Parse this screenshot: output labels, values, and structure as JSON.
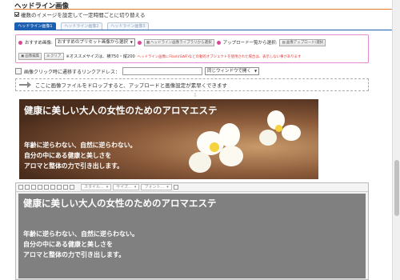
{
  "section": {
    "title": "ヘッドライン画像",
    "rotate_label": "複数のイメージを設定して一定時間ごとに切り替える",
    "rotate_checked": true
  },
  "tabs": [
    "ヘッドライン画像1",
    "ヘッドライン画像2",
    "ヘッドライン画像3"
  ],
  "settings": {
    "preset_label": "おすすめ画像:",
    "preset_select": "おすすめのプリセット画像から選択",
    "library_button": "ヘッドライン画像ライブラリから選択",
    "upload_label": "アップロード一覧から選択:",
    "upload_button": "画像アップロード/選択",
    "edit_button": "画像編集",
    "clear_button": "クリア",
    "size_note": "※オススメサイズは、横750・縦200",
    "warning": "ヘッドライン画像にFlash(SWF)などの動的オブジェクトを使用された場合は、表示しない事があります"
  },
  "link": {
    "label": "画像クリック時に遷移するリンクアドレス：",
    "value": "",
    "window_select": "同じウィンドウで開く"
  },
  "drop_zone": {
    "text": "ここに画像ファイルをドロップすると、アップロードと画像設定が素早くできます"
  },
  "banner": {
    "title": "健康に美しい大人の女性のためのアロマエステ",
    "lines": [
      "年齢に逆らわない、自然に逆らわない。",
      "自分の中にある健康と美しさを",
      "アロマと整体の力で引き出します。"
    ]
  },
  "editor": {
    "style_placeholder": "スタイル...",
    "size_placeholder": "サイズ...",
    "font_placeholder": "フォント...",
    "title": "健康に美しい大人の女性のためのアロマエステ",
    "lines": [
      "年齢に逆らわない、自然に逆らわない。",
      "自分の中にある健康と美しさを",
      "アロマと整体の力で引き出します。"
    ]
  },
  "colors": {
    "accent_orange": "#e07a2a",
    "tab_blue": "#1d5fb0",
    "box_pink": "#e08bd2",
    "warning_red": "#e23a3a"
  }
}
